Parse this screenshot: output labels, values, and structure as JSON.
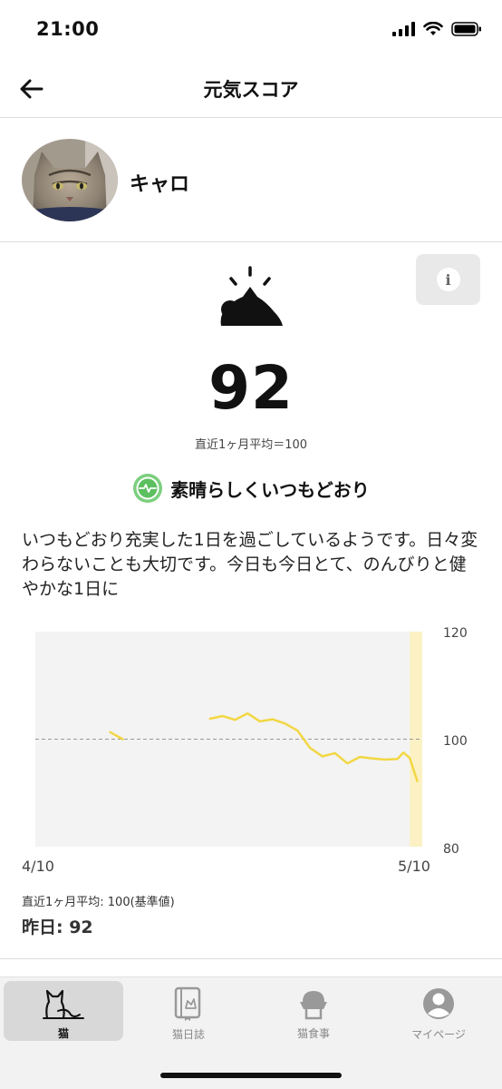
{
  "status_bar": {
    "time": "21:00"
  },
  "nav": {
    "title": "元気スコア"
  },
  "profile": {
    "name": "キャロ"
  },
  "score": {
    "value": "92",
    "monthly_average": "直近1ヶ月平均＝100",
    "status_label": "素晴らしくいつもどおり",
    "description": "いつもどおり充実した1日を過ごしているようです。日々変わらないことも大切です。今日も今日とて、のんびりと健やかな1日に",
    "info_label": "i"
  },
  "chart_data": {
    "type": "line",
    "title": "",
    "xlabel": "",
    "ylabel": "",
    "x_start_label": "4/10",
    "x_end_label": "5/10",
    "y_ticks": [
      "120",
      "100",
      "80"
    ],
    "ylim": [
      80,
      120
    ],
    "baseline": 100,
    "day_count": 31,
    "highlight_last_day": true,
    "series": [
      {
        "color": "#f2d743",
        "segments": [
          [
            [
              6,
              101.3
            ],
            [
              7,
              100.0
            ]
          ],
          [
            [
              14,
              103.8
            ],
            [
              15,
              104.3
            ],
            [
              16,
              103.6
            ],
            [
              17,
              104.8
            ],
            [
              18,
              103.3
            ],
            [
              19,
              103.7
            ],
            [
              20,
              102.9
            ],
            [
              21,
              101.6
            ],
            [
              22,
              98.4
            ],
            [
              23,
              96.8
            ],
            [
              24,
              97.4
            ],
            [
              25,
              95.5
            ],
            [
              26,
              96.7
            ],
            [
              27,
              96.4
            ],
            [
              28,
              96.2
            ],
            [
              29,
              96.3
            ],
            [
              29.5,
              97.5
            ],
            [
              30,
              96.5
            ],
            [
              30.6,
              92.2
            ]
          ]
        ]
      }
    ],
    "footnote": "直近1ヶ月平均: 100(基準値)",
    "yesterday": "昨日: 92",
    "grid": false
  },
  "tabs": [
    {
      "label": "猫",
      "icon": "cat-icon",
      "active": true
    },
    {
      "label": "猫日誌",
      "icon": "diary-icon",
      "active": false
    },
    {
      "label": "猫食事",
      "icon": "food-bowl-icon",
      "active": false
    },
    {
      "label": "マイページ",
      "icon": "user-icon",
      "active": false
    }
  ]
}
